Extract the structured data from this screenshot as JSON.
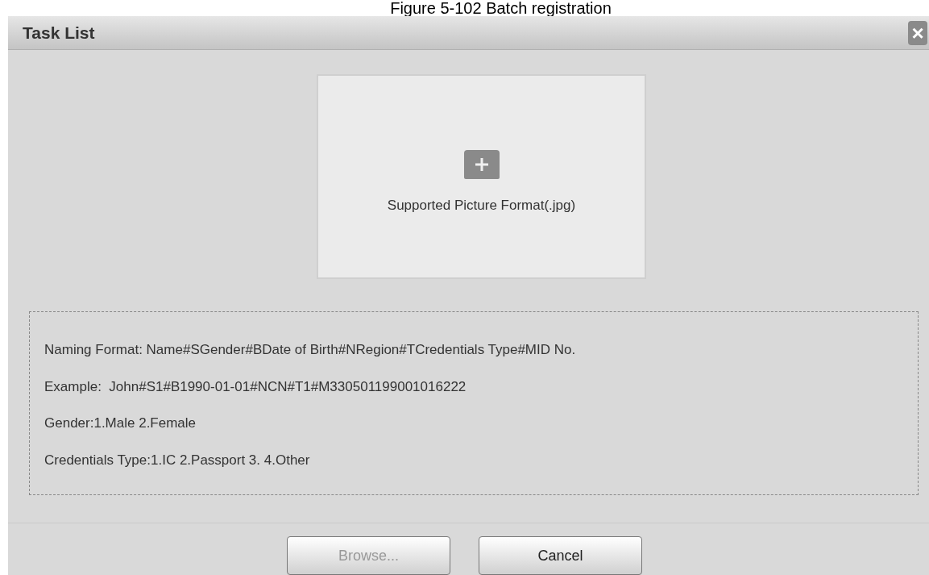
{
  "caption": "Figure 5-102 Batch registration",
  "dialog": {
    "title": "Task List",
    "close": "×"
  },
  "upload": {
    "hint": "Supported Picture Format(.jpg)"
  },
  "info_lines": [
    "Naming Format: Name#SGender#BDate of Birth#NRegion#TCredentials Type#MID No.",
    "Example:  John#S1#B1990-01-01#NCN#T1#M330501199001016222",
    "Gender:1.Male 2.Female",
    "Credentials Type:1.IC 2.Passport 3. 4.Other"
  ],
  "buttons": [
    {
      "label": "Browse...",
      "disabled": true
    },
    {
      "label": "Cancel",
      "disabled": false
    }
  ]
}
